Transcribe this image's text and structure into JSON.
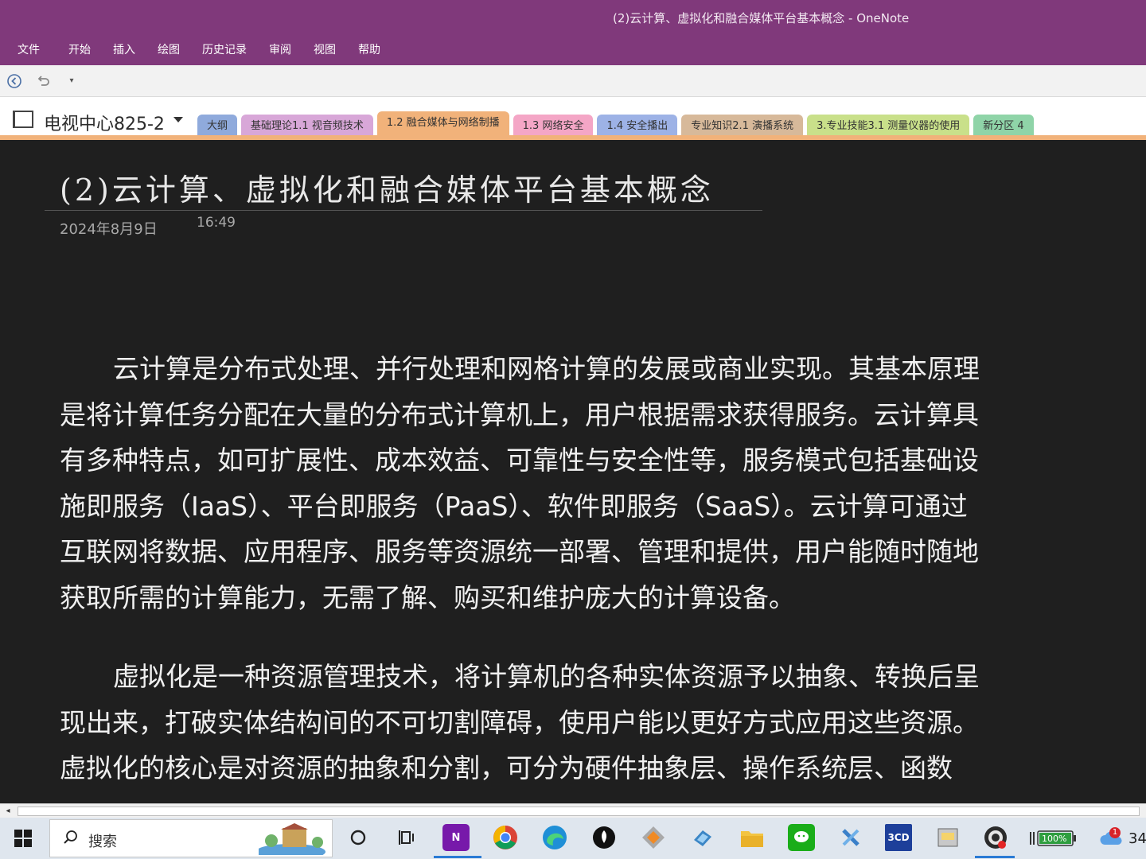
{
  "window": {
    "title": "(2)云计算、虚拟化和融合媒体平台基本概念  -  OneNote"
  },
  "ribbon": {
    "tabs": [
      "文件",
      "开始",
      "插入",
      "绘图",
      "历史记录",
      "审阅",
      "视图",
      "帮助"
    ]
  },
  "quick_access": {
    "icons": [
      "back-icon",
      "undo-icon",
      "customize-icon"
    ]
  },
  "notebook": {
    "name": "电视中心825-2"
  },
  "sections": [
    {
      "label": "大纲",
      "color": "#8faadc"
    },
    {
      "label": "基础理论1.1 视音频技术",
      "color": "#d8a7d8"
    },
    {
      "label": "1.2 融合媒体与网络制播",
      "color": "#f1b27a",
      "active": true
    },
    {
      "label": "1.3 网络安全",
      "color": "#f4a6c6"
    },
    {
      "label": "1.4 安全播出",
      "color": "#9db2e6"
    },
    {
      "label": "专业知识2.1 演播系统",
      "color": "#d7b99a"
    },
    {
      "label": "3.专业技能3.1 测量仪器的使用",
      "color": "#c9e08a"
    },
    {
      "label": "新分区 4",
      "color": "#8fd4a8"
    }
  ],
  "page": {
    "title": "(2)云计算、虚拟化和融合媒体平台基本概念",
    "date": "2024年8月9日",
    "time": "16:49",
    "paragraphs": [
      "云计算是分布式处理、并行处理和网格计算的发展或商业实现。其基本原理是将计算任务分配在大量的分布式计算机上，用户根据需求获得服务。云计算具有多种特点，如可扩展性、成本效益、可靠性与安全性等，服务模式包括基础设施即服务（IaaS）、平台即服务（PaaS）、软件即服务（SaaS）。云计算可通过互联网将数据、应用程序、服务等资源统一部署、管理和提供，用户能随时随地获取所需的计算能力，无需了解、购买和维护庞大的计算设备。",
      "虚拟化是一种资源管理技术，将计算机的各种实体资源予以抽象、转换后呈现出来，打破实体结构间的不可切割障碍，使用户能以更好方式应用这些资源。虚拟化的核心是对资源的抽象和分割，可分为硬件抽象层、操作系统层、函数"
    ]
  },
  "taskbar": {
    "search_placeholder": "搜索",
    "apps": [
      "cortana-icon",
      "task-view-icon",
      "onenote-icon",
      "chrome-icon",
      "edge-icon",
      "pen-app-icon",
      "maps-app-icon",
      "remote-icon",
      "file-explorer-icon",
      "wechat-icon",
      "tool-app-icon",
      "3cd-icon",
      "calc-app-icon",
      "obs-icon"
    ],
    "app_3cd_label": "3CD",
    "battery": "100%",
    "notification_count": "1",
    "clock_partial": "34"
  }
}
